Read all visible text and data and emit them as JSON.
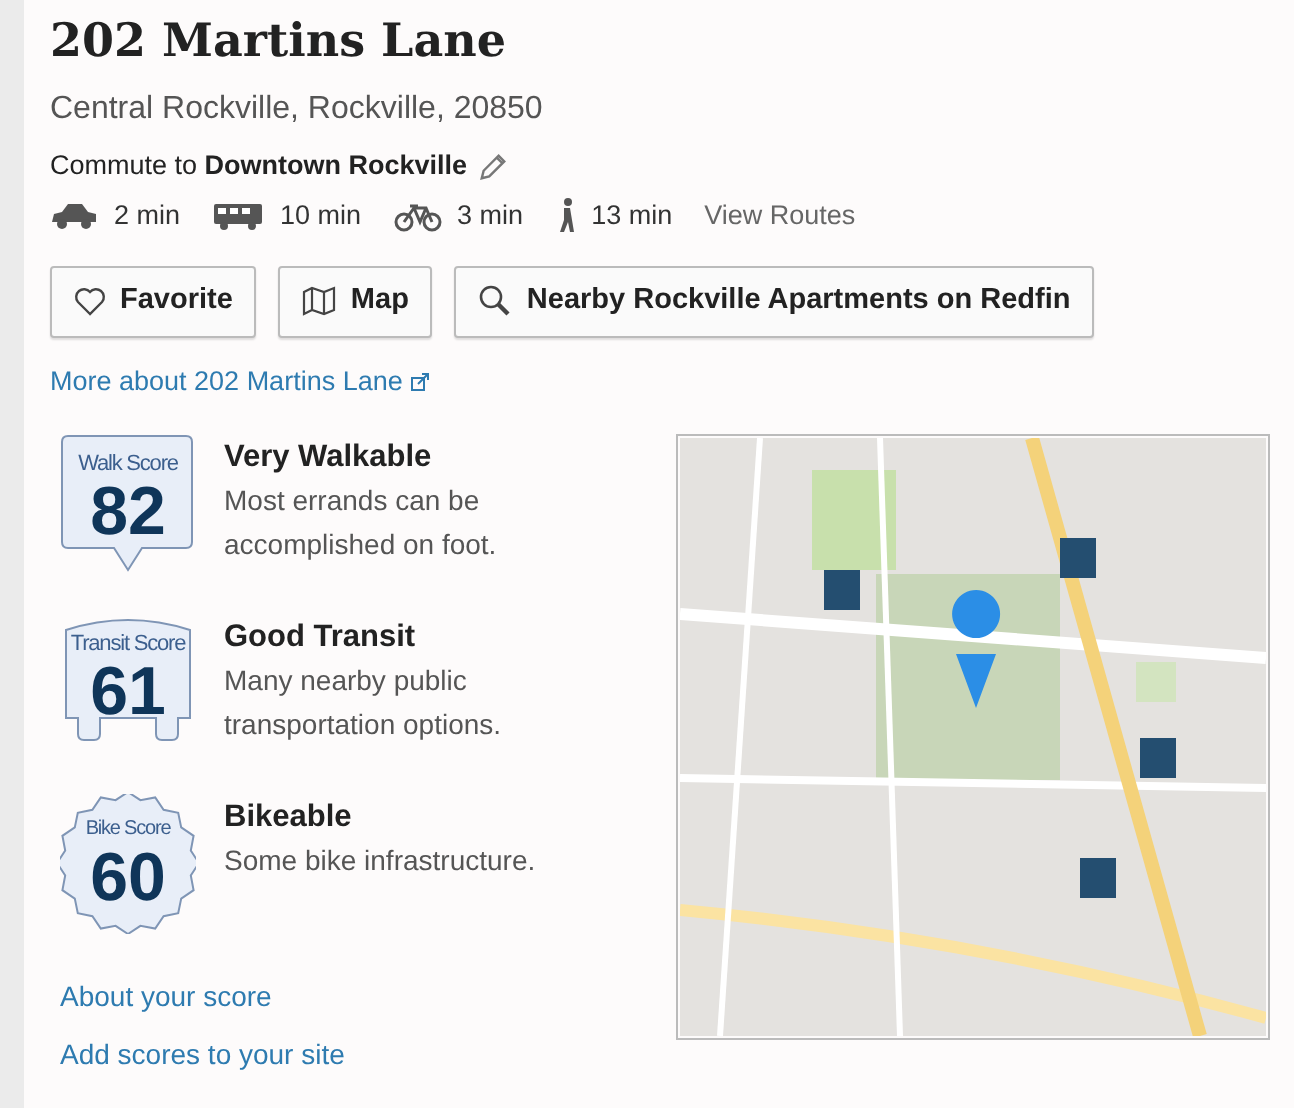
{
  "address": "202 Martins Lane",
  "locality": "Central Rockville, Rockville, 20850",
  "commute": {
    "text": "Commute to **Downtown Rockville**"
  },
  "travel": [
    {
      "kind": "car",
      "time": "2 min"
    },
    {
      "kind": "bus",
      "time": "10 min"
    },
    {
      "kind": "bike",
      "time": "3 min"
    },
    {
      "kind": "walk",
      "time": "13 min"
    }
  ],
  "view_routes": "View Routes",
  "buttons": [
    {
      "kind": "heart",
      "label": "Favorite"
    },
    {
      "kind": "map",
      "label": "Map"
    },
    {
      "kind": "search",
      "label": "Nearby Rockville Apartments on Redfin"
    }
  ],
  "more_link": "More about 202 Martins Lane",
  "scores": [
    {
      "kind": "walk",
      "badge_label": "Walk Score",
      "value": "82",
      "title": "Very Walkable",
      "description": "Most errands can be accomplished on foot."
    },
    {
      "kind": "transit",
      "badge_label": "Transit Score",
      "value": "61",
      "title": "Good Transit",
      "description": "Many nearby public transportation options."
    },
    {
      "kind": "bike",
      "badge_label": "Bike Score",
      "value": "60",
      "title": "Bikeable",
      "description": "Some bike infrastructure."
    }
  ],
  "footer_links": [
    "About your score",
    "Add scores to your site"
  ]
}
